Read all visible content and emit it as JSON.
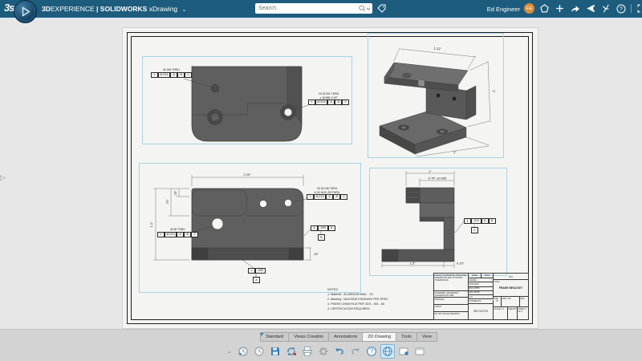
{
  "topbar": {
    "logo": "3s",
    "brand_3d": "3D",
    "brand_exp": "EXPERIENCE",
    "brand_sw": "| SOLIDWORKS",
    "app": "xDrawing",
    "chevron": "⌄",
    "search_placeholder": "Search",
    "user": "Ed Engineer",
    "initials": "EE",
    "icons": [
      "tag",
      "notifications",
      "add",
      "share",
      "community",
      "apps",
      "help",
      "fullscreen"
    ]
  },
  "panel": {
    "expand_glyph": "▷"
  },
  "drawing": {
    "top_view": {
      "callout_left_1": "Ø.196 THRU",
      "fcf_left": [
        "⌖",
        "Ø.014",
        "A",
        "B",
        "C"
      ],
      "callout_right_1": "2X Ø.201 THRU",
      "callout_right_2": "∨ Ø.385 X 82°",
      "fcf_right": [
        "⌖",
        "Ø.014",
        "A",
        "B",
        "C"
      ]
    },
    "iso_view": {
      "dim_width": "1.12\"",
      "dim_height": "1\"",
      "dim_depth": "1\""
    },
    "front_view": {
      "dim_width": "2.25\"",
      "dim_step": ".25\"",
      "dim_upper": ".75\"",
      "dim_height": "1.1\"",
      "dim_base": ".15\"",
      "callout_holes_1": "2X Ø.136 THRU",
      "callout_holes_2": "6-32 UNC-2B THRU",
      "fcf_holes": [
        "⌖",
        "Ø.014",
        "A",
        "B",
        "C"
      ],
      "callout_hole_1": "Ø.38 THRU",
      "fcf_hole": [
        "⌖",
        "Ø.010",
        "A",
        "B",
        "C"
      ],
      "fcf_right": [
        "∥",
        ".005",
        "A"
      ],
      "datum_right": "B",
      "fcf_bottom": [
        "⊥",
        ".005"
      ],
      "datum_bottom": "A"
    },
    "side_view": {
      "dim_top": "1\"",
      "dim_flange": "0.75\" ±0.005",
      "dim_bottom": "1.5\"",
      "dim_thickness": "0.16\"",
      "fcf_right": [
        "∥",
        ".010",
        "A",
        "B"
      ],
      "datum_right": "C"
    },
    "notes": [
      "NOTES:",
      "1. Material : ALUMINUM 6061 - T6",
      "2. Marking : MACHINE ENGRAVE PER SPEC",
      "3. FINISH CHEM FILM PER 3DS - 001 - 60",
      "4. CERTIFICATION REQUIRED"
    ],
    "title_block": {
      "spec_header": "UNLESS OTHERWISE SPECIFIED:",
      "spec_line1": "DIMENSIONS ARE IN INCHES",
      "spec_line2": "TOLERANCES:",
      "interpret": "INTERPRET GEOMETRIC TOLERANCING PER:",
      "material_label": "MATERIAL",
      "finish_label": "FINISH",
      "do_not_scale": "DO NOT SCALE DRAWING",
      "name_col": "NAME",
      "date_col": "DATE",
      "rows": [
        "DRAWN",
        "CHECKED",
        "ENG APPR.",
        "MFG APPR.",
        "Q.A.",
        "COMMENTS:"
      ],
      "material_value": "SEE NOTES",
      "na": "N/A",
      "title_label": "TITLE:",
      "title": "FRAME BRACKET",
      "size_label": "SIZE",
      "size": "B",
      "dwg_label": "DWG. NO.",
      "rev_label": "REV",
      "scale": "SCALE: 1:1",
      "weight": "WEIGHT:",
      "sheet": "SHEET 1 OF 1"
    }
  },
  "tabs": {
    "items": [
      {
        "label": "Standard"
      },
      {
        "label": "Views Creation"
      },
      {
        "label": "Annotations"
      },
      {
        "label": "2D Drawing"
      },
      {
        "label": "Tools"
      },
      {
        "label": "View"
      }
    ],
    "active": "2D Drawing"
  },
  "toolbar": {
    "icons": [
      "versions",
      "history",
      "save",
      "update",
      "print",
      "settings",
      "undo",
      "redo",
      "help",
      "3d-mode",
      "new-sheet",
      "sheet-setup"
    ]
  },
  "colors": {
    "topbar": "#1e5c7d",
    "accent": "#3a7fb5",
    "view_border": "#a7d3e6",
    "avatar": "#d98e38"
  }
}
